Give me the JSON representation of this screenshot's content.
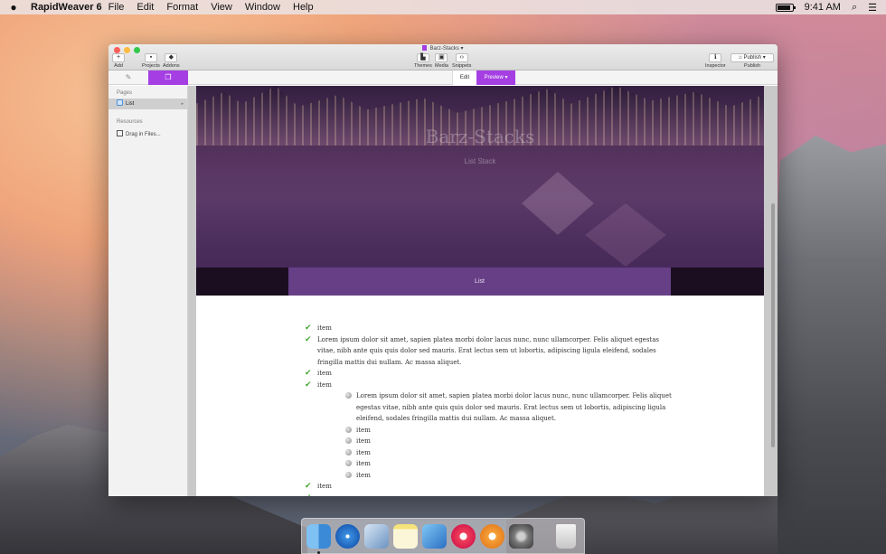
{
  "menubar": {
    "app_name": "RapidWeaver 6",
    "menus": [
      "File",
      "Edit",
      "Format",
      "View",
      "Window",
      "Help"
    ],
    "clock": "9:41 AM",
    "battery_level": 0.9
  },
  "window": {
    "title": "Barz-Stacks",
    "toolbar": {
      "add": "Add",
      "projects": "Projects",
      "addons": "Addons",
      "themes": "Themes",
      "media": "Media",
      "snippets": "Snippets",
      "inspector": "Inspector",
      "publish_button": "Publish",
      "publish": "Publish"
    },
    "modes": {
      "edit": "Edit",
      "preview": "Preview"
    }
  },
  "sidebar": {
    "pages_heading": "Pages",
    "page_item": "List",
    "resources_heading": "Resources",
    "drag_files": "Drag in Files..."
  },
  "site": {
    "title": "Barz-Stacks",
    "subtitle": "List Stack",
    "nav_item": "List",
    "lorem": "Lorem ipsum dolor sit amet, sapien platea morbi dolor lacus nunc, nunc ullamcorper. Felis aliquet egestas vitae, nibh ante quis quis dolor sed mauris. Erat lectus sem ut lobortis, adipiscing ligula eleifend, sodales fringilla mattis dui nullam. Ac massa aliquet.",
    "item": "item"
  },
  "colors": {
    "accent": "#a53fe3",
    "nav": "#663f86",
    "check": "#4aa838"
  },
  "dock": {
    "apps": [
      "finder-icon",
      "safari-icon",
      "preview-icon",
      "notes-icon",
      "rapidweaver-icon",
      "itunes-icon",
      "ibooks-icon",
      "system-preferences-icon",
      "trash-icon"
    ]
  }
}
